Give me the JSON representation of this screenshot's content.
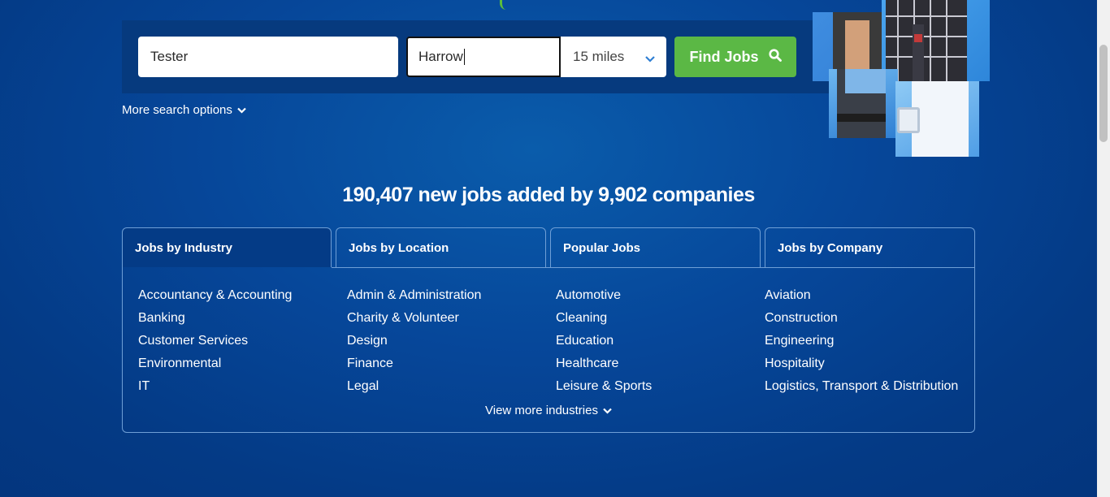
{
  "search": {
    "keyword_value": "Tester",
    "location_value": "Harrow",
    "radius_value": "15 miles",
    "find_label": "Find Jobs",
    "more_options": "More search options"
  },
  "headline": "190,407 new jobs added by 9,902 companies",
  "tabs": [
    {
      "label": "Jobs by Industry",
      "active": true
    },
    {
      "label": "Jobs by Location"
    },
    {
      "label": "Popular Jobs"
    },
    {
      "label": "Jobs by Company"
    }
  ],
  "columns": [
    [
      "Accountancy & Accounting",
      "Banking",
      "Customer Services",
      "Environmental",
      "IT"
    ],
    [
      "Admin & Administration",
      "Charity & Volunteer",
      "Design",
      "Finance",
      "Legal"
    ],
    [
      "Automotive",
      "Cleaning",
      "Education",
      "Healthcare",
      "Leisure & Sports"
    ],
    [
      "Aviation",
      "Construction",
      "Engineering",
      "Hospitality",
      "Logistics, Transport & Distribution"
    ]
  ],
  "view_more": "View more industries",
  "colors": {
    "accent_green": "#5bb845",
    "background_blue": "#06479a",
    "tab_border": "#6f9fd6"
  },
  "icons": {
    "search": "search-icon",
    "chevron": "chevron-down-icon"
  }
}
